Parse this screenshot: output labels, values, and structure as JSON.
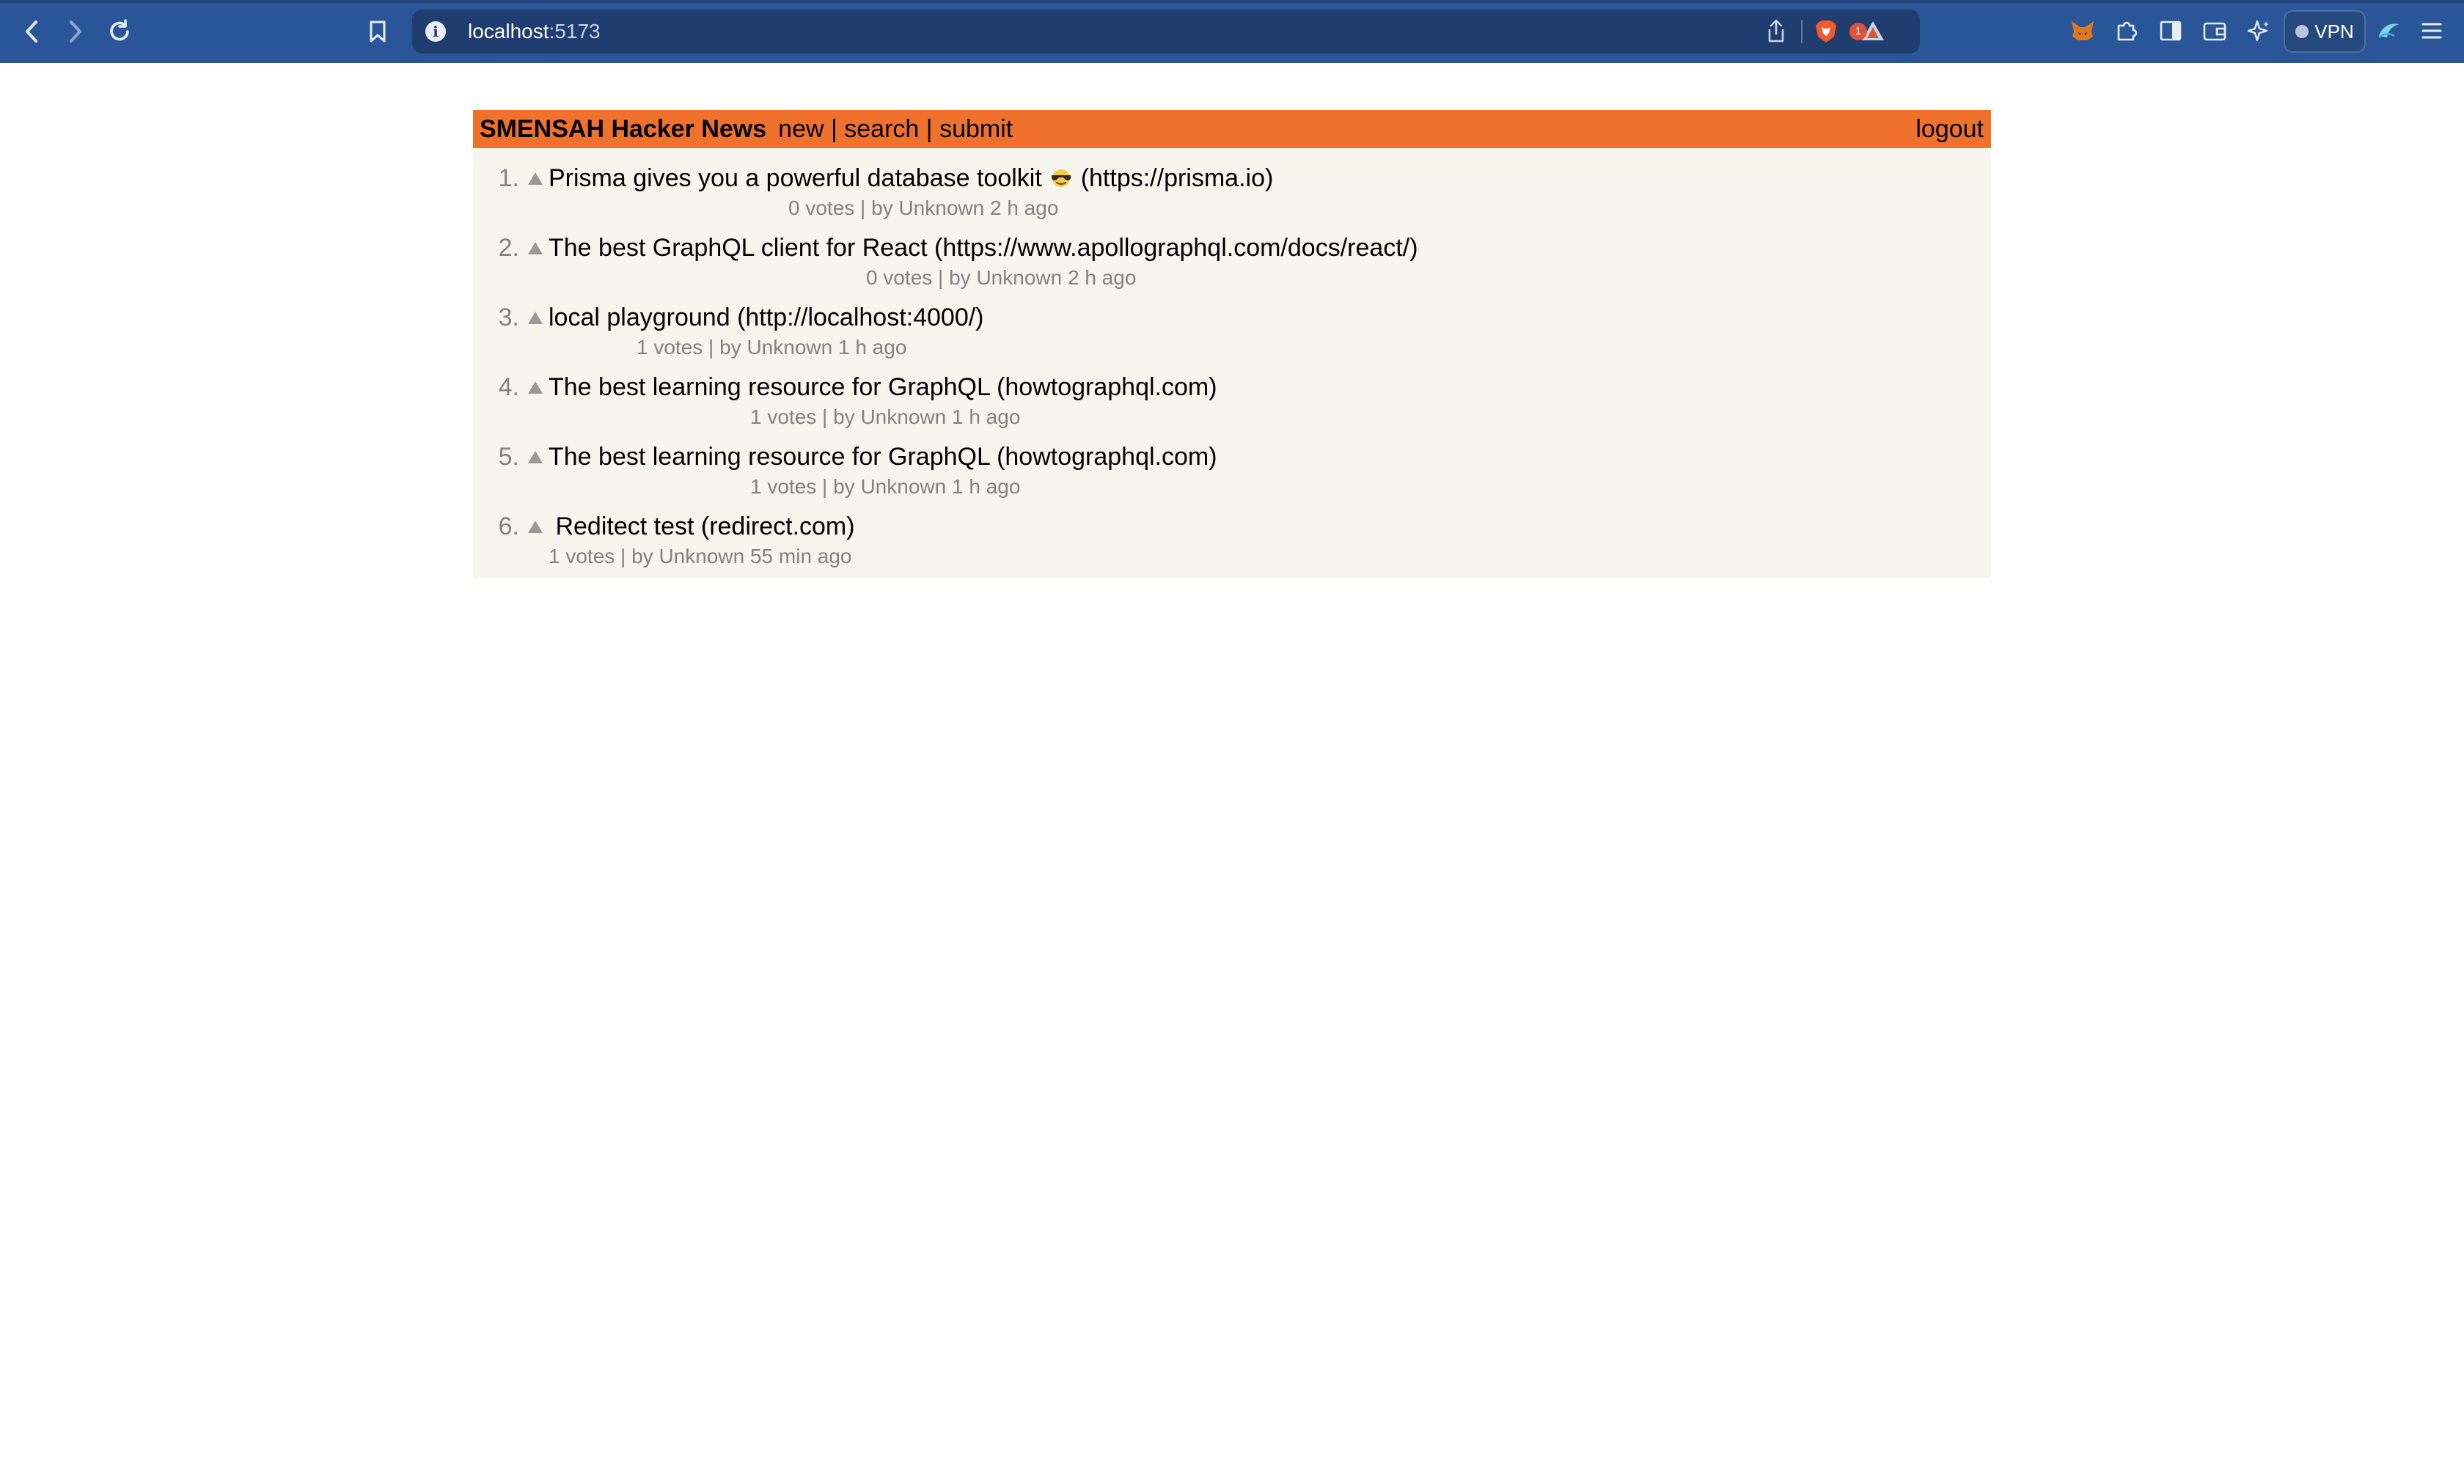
{
  "browser": {
    "url_host": "localhost",
    "url_port": ":5173",
    "notification_count": "1",
    "vpn_label": "VPN"
  },
  "header": {
    "brand": "SMENSAH Hacker News",
    "new_label": "new",
    "search_label": "search",
    "submit_label": "submit",
    "separator": " | ",
    "logout_label": "logout"
  },
  "stories": [
    {
      "rank": "1.",
      "title": "Prisma gives you a powerful database toolkit",
      "emoji": "smiling-face-with-sunglasses",
      "url": "(https://prisma.io)",
      "meta": "0 votes | by Unknown 2 h ago"
    },
    {
      "rank": "2.",
      "title": "The best GraphQL client for React",
      "url": "(https://www.apollographql.com/docs/react/)",
      "meta": "0 votes | by Unknown 2 h ago"
    },
    {
      "rank": "3.",
      "title": "local playground",
      "url": "(http://localhost:4000/)",
      "meta": "1 votes | by Unknown 1 h ago"
    },
    {
      "rank": "4.",
      "title": "The best learning resource for GraphQL",
      "url": "(howtographql.com)",
      "meta": "1 votes | by Unknown 1 h ago"
    },
    {
      "rank": "5.",
      "title": "The best learning resource for GraphQL",
      "url": "(howtographql.com)",
      "meta": "1 votes | by Unknown 1 h ago"
    },
    {
      "rank": "6.",
      "title": " Reditect test",
      "url": "(redirect.com)",
      "meta": "1 votes | by Unknown 55 min ago"
    }
  ],
  "colors": {
    "header_orange": "#f0712c",
    "page_bg": "#f6f6ef",
    "meta_gray": "#828282",
    "chrome_blue": "#2a5599"
  }
}
